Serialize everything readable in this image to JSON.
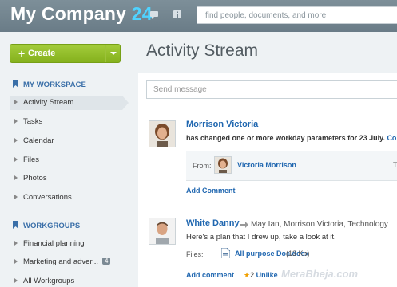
{
  "header": {
    "brand_name": "My Company",
    "brand_number": "24",
    "search_placeholder": "find people, documents, and more"
  },
  "sidebar": {
    "create_label": "Create",
    "my_workspace_title": "MY WORKSPACE",
    "workspace_items": [
      {
        "label": "Activity Stream",
        "active": true
      },
      {
        "label": "Tasks"
      },
      {
        "label": "Calendar"
      },
      {
        "label": "Files"
      },
      {
        "label": "Photos"
      },
      {
        "label": "Conversations"
      }
    ],
    "workgroups_title": "WORKGROUPS",
    "workgroup_items": [
      {
        "label": "Financial planning"
      },
      {
        "label": "Marketing and adver...",
        "badge": "4"
      },
      {
        "label": "All Workgroups"
      }
    ]
  },
  "main": {
    "title": "Activity Stream",
    "send_placeholder": "Send message",
    "post1": {
      "author": "Morrison Victoria",
      "text": "has changed one or more workday parameters for 23 July.",
      "text_link": "Confi",
      "from_label": "From:",
      "from_name": "Victoria Morrison",
      "from_trailing": "T",
      "add_comment": "Add Comment"
    },
    "post2": {
      "author": "White Danny",
      "recipients": "May Ian, Morrison Victoria, Technology",
      "text": "Here's a plan that I drew up, take a look at it.",
      "files_label": "Files:",
      "file_name": "All purpose Doc.docx",
      "file_size": "(13 Kb)",
      "add_comment": "Add comment",
      "likes": "2",
      "unlike": "Unlike"
    },
    "watermark": "MeraBheja.com"
  },
  "colors": {
    "header": "#6f818c",
    "brand_accent": "#4fd3ff",
    "create_green": "#94bf2b",
    "link_blue": "#2067b0"
  }
}
